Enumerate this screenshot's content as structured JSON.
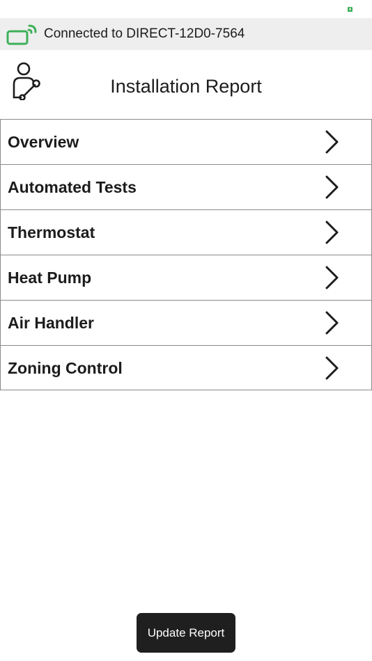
{
  "status_bar": {
    "battery_icon": "battery-charging-icon",
    "battery_color": "#3db05a"
  },
  "connection": {
    "icon": "wifi-connected-device-icon",
    "icon_color": "#3db05a",
    "text": "Connected to DIRECT-12D0-7564"
  },
  "header": {
    "icon": "installer-wrench-icon",
    "title": "Installation Report"
  },
  "menu": {
    "items": [
      {
        "label": "Overview"
      },
      {
        "label": "Automated Tests"
      },
      {
        "label": "Thermostat"
      },
      {
        "label": "Heat Pump"
      },
      {
        "label": "Air Handler"
      },
      {
        "label": "Zoning Control"
      }
    ],
    "chevron_icon": "chevron-right-icon"
  },
  "footer": {
    "update_button_label": "Update Report"
  },
  "colors": {
    "accent": "#3db05a",
    "button_background": "#1f1f1f",
    "connection_bar_background": "#eeeeee",
    "divider": "#8a8a8a"
  }
}
